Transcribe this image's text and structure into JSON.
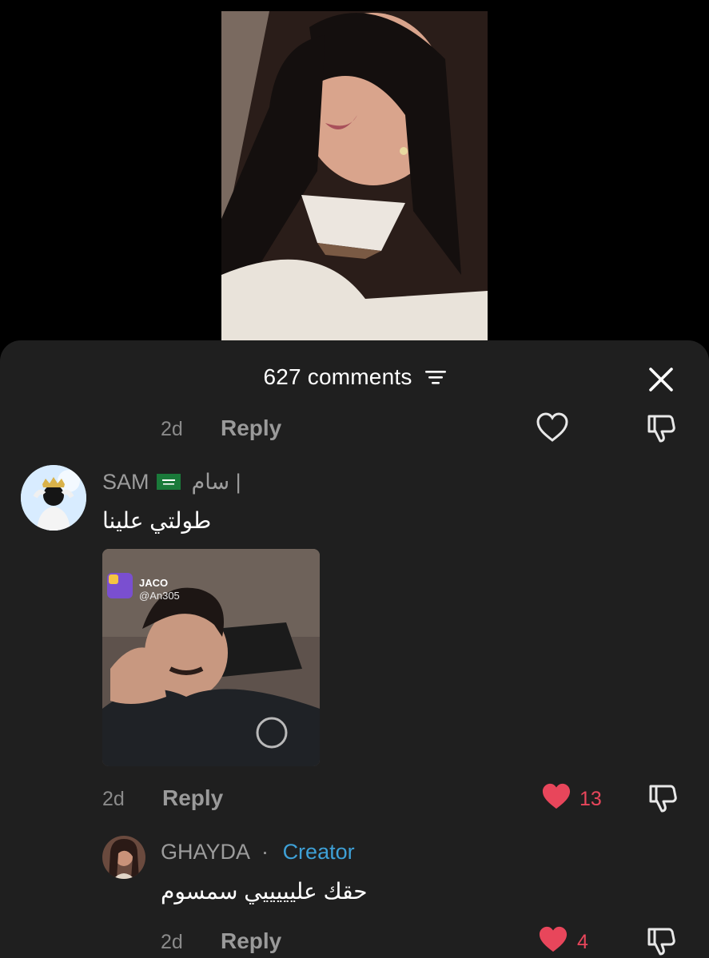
{
  "header": {
    "comments_label": "627 comments"
  },
  "colors": {
    "sheet_bg": "#1f1f1f",
    "like_red": "#e8465b",
    "creator_blue": "#3ea0d6",
    "muted_text": "#9c9c9c"
  },
  "comments": [
    {
      "time": "2d",
      "reply_label": "Reply",
      "liked": false
    },
    {
      "username": "SAM",
      "flag_icon": "saudi-flag-icon",
      "username_suffix": "| سام",
      "text": "طولتي علينا",
      "attachment": {
        "watermark_name": "JACO",
        "watermark_handle": "@An305"
      },
      "time": "2d",
      "reply_label": "Reply",
      "liked": true,
      "like_count": "13"
    },
    {
      "username": "GHAYDA",
      "separator": "·",
      "badge": "Creator",
      "text": "حقك عليييييي سمسوم",
      "time": "2d",
      "reply_label": "Reply",
      "liked": true,
      "like_count": "4"
    }
  ]
}
